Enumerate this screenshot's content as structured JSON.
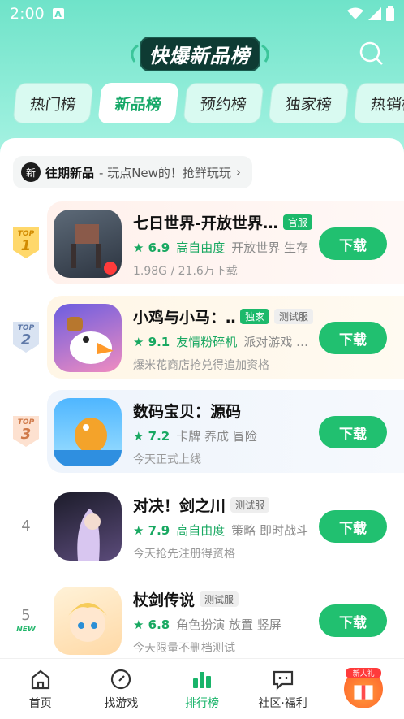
{
  "status": {
    "time": "2:00",
    "notif_letter": "A"
  },
  "header": {
    "logo_text": "快爆新品榜"
  },
  "tabs": [
    {
      "label": "热门榜"
    },
    {
      "label": "新品榜"
    },
    {
      "label": "预约榜"
    },
    {
      "label": "独家榜"
    },
    {
      "label": "热销榜"
    }
  ],
  "past": {
    "badge": "新",
    "title": "往期新品",
    "subtitle": " - 玩点New的！抢鲜玩玩",
    "arrow": "›"
  },
  "list": [
    {
      "rank_top": "TOP",
      "rank": "1",
      "title": "七日世界-开放世界…",
      "tag": "官服",
      "score": "★ 6.9",
      "highlight": "高自由度",
      "cats": "开放世界  生存",
      "desc": "1.98G / 21.6万下载",
      "button": "下载"
    },
    {
      "rank_top": "TOP",
      "rank": "2",
      "title": "小鸡与小马：…",
      "tag": "独家",
      "tag2": "测试服",
      "score": "★ 9.1",
      "highlight": "友情粉碎机",
      "cats": "派对游戏  …",
      "desc": "爆米花商店抢兑得追加资格",
      "button": "下载"
    },
    {
      "rank_top": "TOP",
      "rank": "3",
      "title": "数码宝贝：源码",
      "score": "★ 7.2",
      "cats": "卡牌  养成  冒险",
      "desc": "今天正式上线",
      "button": "下载"
    },
    {
      "rank": "4",
      "title": "对决！剑之川",
      "tag2": "测试服",
      "score": "★ 7.9",
      "highlight": "高自由度",
      "cats": "策略  即时战斗",
      "desc": "今天抢先注册得资格",
      "button": "下载"
    },
    {
      "rank": "5",
      "new_label": "NEW",
      "title": "杖剑传说",
      "tag2": "测试服",
      "score": "★ 6.8",
      "highlight": "",
      "cats": "角色扮演  放置  竖屏",
      "desc": "今天限量不删档测试",
      "button": "下载"
    }
  ],
  "nav": [
    {
      "label": "首页"
    },
    {
      "label": "找游戏"
    },
    {
      "label": "排行榜"
    },
    {
      "label": "社区·福利"
    },
    {
      "label": "新人礼"
    }
  ],
  "colors": {
    "accent": "#21c070",
    "header_gradient_top": "#6fe3c9"
  }
}
